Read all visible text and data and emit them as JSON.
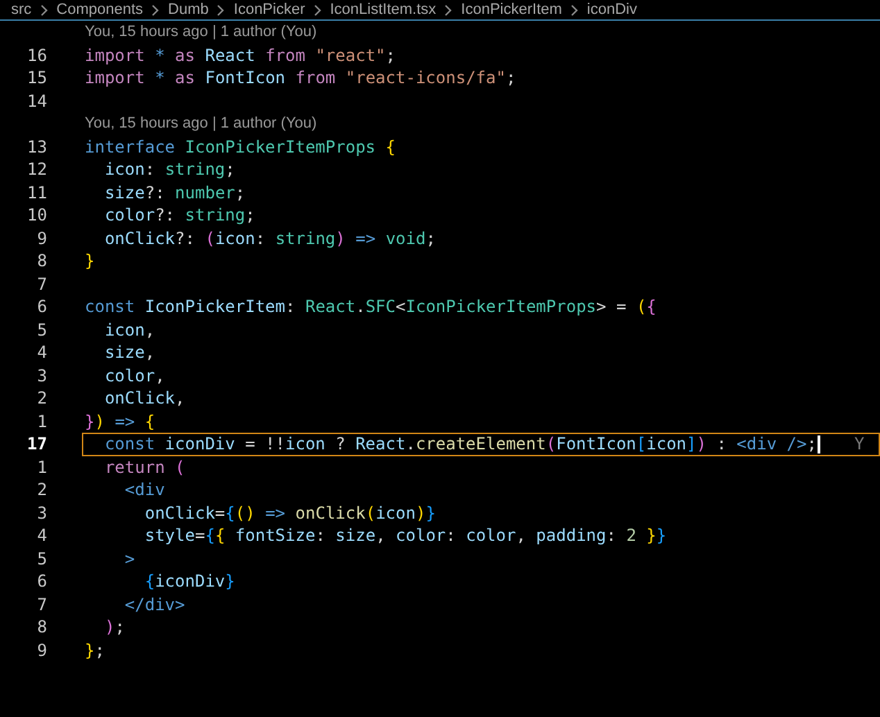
{
  "breadcrumb": [
    "src",
    "Components",
    "Dumb",
    "IconPicker",
    "IconListItem.tsx",
    "IconPickerItem",
    "iconDiv"
  ],
  "lines": [
    {
      "kind": "blame",
      "text": "You, 15 hours ago | 1 author (You)"
    },
    {
      "kind": "code",
      "number": "16",
      "current": false,
      "tokens": [
        {
          "kind": "kw",
          "text": "import "
        },
        {
          "kind": "op",
          "text": "* "
        },
        {
          "kind": "kw",
          "text": "as "
        },
        {
          "kind": "var",
          "text": "React "
        },
        {
          "kind": "kw",
          "text": "from "
        },
        {
          "kind": "str",
          "text": "\"react\""
        },
        {
          "kind": "p",
          "text": ";"
        }
      ]
    },
    {
      "kind": "code",
      "number": "15",
      "current": false,
      "tokens": [
        {
          "kind": "kw",
          "text": "import "
        },
        {
          "kind": "op",
          "text": "* "
        },
        {
          "kind": "kw",
          "text": "as "
        },
        {
          "kind": "var",
          "text": "FontIcon "
        },
        {
          "kind": "kw",
          "text": "from "
        },
        {
          "kind": "str",
          "text": "\"react-icons/fa\""
        },
        {
          "kind": "p",
          "text": ";"
        }
      ]
    },
    {
      "kind": "code",
      "number": "14",
      "current": false
    },
    {
      "kind": "blame",
      "text": "You, 15 hours ago | 1 author (You)"
    },
    {
      "kind": "code",
      "number": "13",
      "current": false,
      "tokens": [
        {
          "kind": "st",
          "text": "interface "
        },
        {
          "kind": "type",
          "text": "IconPickerItemProps "
        },
        {
          "kind": "b1",
          "text": "{"
        }
      ]
    },
    {
      "kind": "code",
      "number": "12",
      "current": false,
      "tokens": [
        {
          "kind": "var",
          "text": "  icon"
        },
        {
          "kind": "p",
          "text": ": "
        },
        {
          "kind": "type",
          "text": "string"
        },
        {
          "kind": "p",
          "text": ";"
        }
      ]
    },
    {
      "kind": "code",
      "number": "11",
      "current": false,
      "tokens": [
        {
          "kind": "var",
          "text": "  size"
        },
        {
          "kind": "p",
          "text": "?: "
        },
        {
          "kind": "type",
          "text": "number"
        },
        {
          "kind": "p",
          "text": ";"
        }
      ]
    },
    {
      "kind": "code",
      "number": "10",
      "current": false,
      "tokens": [
        {
          "kind": "var",
          "text": "  color"
        },
        {
          "kind": "p",
          "text": "?: "
        },
        {
          "kind": "type",
          "text": "string"
        },
        {
          "kind": "p",
          "text": ";"
        }
      ]
    },
    {
      "kind": "code",
      "number": "9",
      "current": false,
      "tokens": [
        {
          "kind": "var",
          "text": "  onClick"
        },
        {
          "kind": "p",
          "text": "?: "
        },
        {
          "kind": "b2",
          "text": "("
        },
        {
          "kind": "var",
          "text": "icon"
        },
        {
          "kind": "p",
          "text": ": "
        },
        {
          "kind": "type",
          "text": "string"
        },
        {
          "kind": "b2",
          "text": ") "
        },
        {
          "kind": "st",
          "text": "=> "
        },
        {
          "kind": "type",
          "text": "void"
        },
        {
          "kind": "p",
          "text": ";"
        }
      ]
    },
    {
      "kind": "code",
      "number": "8",
      "current": false,
      "tokens": [
        {
          "kind": "b1",
          "text": "}"
        }
      ]
    },
    {
      "kind": "code",
      "number": "7",
      "current": false
    },
    {
      "kind": "code",
      "number": "6",
      "current": false,
      "tokens": [
        {
          "kind": "st",
          "text": "const "
        },
        {
          "kind": "var",
          "text": "IconPickerItem"
        },
        {
          "kind": "p",
          "text": ": "
        },
        {
          "kind": "type",
          "text": "React"
        },
        {
          "kind": "p",
          "text": "."
        },
        {
          "kind": "type",
          "text": "SFC"
        },
        {
          "kind": "p",
          "text": "<"
        },
        {
          "kind": "type",
          "text": "IconPickerItemProps"
        },
        {
          "kind": "p",
          "text": "> = "
        },
        {
          "kind": "b1",
          "text": "("
        },
        {
          "kind": "b2",
          "text": "{"
        }
      ]
    },
    {
      "kind": "code",
      "number": "5",
      "current": false,
      "tokens": [
        {
          "kind": "var",
          "text": "  icon"
        },
        {
          "kind": "p",
          "text": ","
        }
      ]
    },
    {
      "kind": "code",
      "number": "4",
      "current": false,
      "tokens": [
        {
          "kind": "var",
          "text": "  size"
        },
        {
          "kind": "p",
          "text": ","
        }
      ]
    },
    {
      "kind": "code",
      "number": "3",
      "current": false,
      "tokens": [
        {
          "kind": "var",
          "text": "  color"
        },
        {
          "kind": "p",
          "text": ","
        }
      ]
    },
    {
      "kind": "code",
      "number": "2",
      "current": false,
      "tokens": [
        {
          "kind": "var",
          "text": "  onClick"
        },
        {
          "kind": "p",
          "text": ","
        }
      ]
    },
    {
      "kind": "code",
      "number": "1",
      "current": false,
      "tokens": [
        {
          "kind": "b2",
          "text": "}"
        },
        {
          "kind": "b1",
          "text": ") "
        },
        {
          "kind": "st",
          "text": "=> "
        },
        {
          "kind": "b1",
          "text": "{"
        }
      ]
    },
    {
      "kind": "code",
      "number": "17",
      "current": true,
      "tokens": [
        {
          "kind": "st",
          "text": "  const "
        },
        {
          "kind": "var",
          "text": "iconDiv "
        },
        {
          "kind": "p",
          "text": "= !!"
        },
        {
          "kind": "var",
          "text": "icon "
        },
        {
          "kind": "p",
          "text": "? "
        },
        {
          "kind": "var",
          "text": "React"
        },
        {
          "kind": "p",
          "text": "."
        },
        {
          "kind": "fn",
          "text": "createElement"
        },
        {
          "kind": "b2",
          "text": "("
        },
        {
          "kind": "var",
          "text": "FontIcon"
        },
        {
          "kind": "b3",
          "text": "["
        },
        {
          "kind": "var",
          "text": "icon"
        },
        {
          "kind": "b3",
          "text": "]"
        },
        {
          "kind": "b2",
          "text": ") "
        },
        {
          "kind": "p",
          "text": ": "
        },
        {
          "kind": "tag",
          "text": "<div "
        },
        {
          "kind": "tag",
          "text": "/>"
        },
        {
          "kind": "p",
          "text": ";"
        }
      ],
      "inline_blame": "Y"
    },
    {
      "kind": "code",
      "number": "1",
      "current": false,
      "tokens": [
        {
          "kind": "kw",
          "text": "  return "
        },
        {
          "kind": "b2",
          "text": "("
        }
      ]
    },
    {
      "kind": "code",
      "number": "2",
      "current": false,
      "tokens": [
        {
          "kind": "tag",
          "text": "    <div"
        }
      ]
    },
    {
      "kind": "code",
      "number": "3",
      "current": false,
      "tokens": [
        {
          "kind": "var",
          "text": "      onClick"
        },
        {
          "kind": "p",
          "text": "="
        },
        {
          "kind": "b3",
          "text": "{"
        },
        {
          "kind": "b1",
          "text": "() "
        },
        {
          "kind": "st",
          "text": "=> "
        },
        {
          "kind": "fn",
          "text": "onClick"
        },
        {
          "kind": "b1",
          "text": "("
        },
        {
          "kind": "var",
          "text": "icon"
        },
        {
          "kind": "b1",
          "text": ")"
        },
        {
          "kind": "b3",
          "text": "}"
        }
      ]
    },
    {
      "kind": "code",
      "number": "4",
      "current": false,
      "tokens": [
        {
          "kind": "var",
          "text": "      style"
        },
        {
          "kind": "p",
          "text": "="
        },
        {
          "kind": "b3",
          "text": "{"
        },
        {
          "kind": "b1",
          "text": "{ "
        },
        {
          "kind": "var",
          "text": "fontSize"
        },
        {
          "kind": "p",
          "text": ": "
        },
        {
          "kind": "var",
          "text": "size"
        },
        {
          "kind": "p",
          "text": ", "
        },
        {
          "kind": "var",
          "text": "color"
        },
        {
          "kind": "p",
          "text": ": "
        },
        {
          "kind": "var",
          "text": "color"
        },
        {
          "kind": "p",
          "text": ", "
        },
        {
          "kind": "var",
          "text": "padding"
        },
        {
          "kind": "p",
          "text": ": "
        },
        {
          "kind": "num",
          "text": "2 "
        },
        {
          "kind": "b1",
          "text": "}"
        },
        {
          "kind": "b3",
          "text": "}"
        }
      ]
    },
    {
      "kind": "code",
      "number": "5",
      "current": false,
      "tokens": [
        {
          "kind": "tag",
          "text": "    >"
        }
      ]
    },
    {
      "kind": "code",
      "number": "6",
      "current": false,
      "tokens": [
        {
          "kind": "b3",
          "text": "      {"
        },
        {
          "kind": "var",
          "text": "iconDiv"
        },
        {
          "kind": "b3",
          "text": "}"
        }
      ]
    },
    {
      "kind": "code",
      "number": "7",
      "current": false,
      "tokens": [
        {
          "kind": "tag",
          "text": "    </div>"
        }
      ]
    },
    {
      "kind": "code",
      "number": "8",
      "current": false,
      "tokens": [
        {
          "kind": "b2",
          "text": "  )"
        },
        {
          "kind": "p",
          "text": ";"
        }
      ]
    },
    {
      "kind": "code",
      "number": "9",
      "current": false,
      "tokens": [
        {
          "kind": "b1",
          "text": "}"
        },
        {
          "kind": "p",
          "text": ";"
        }
      ]
    }
  ]
}
